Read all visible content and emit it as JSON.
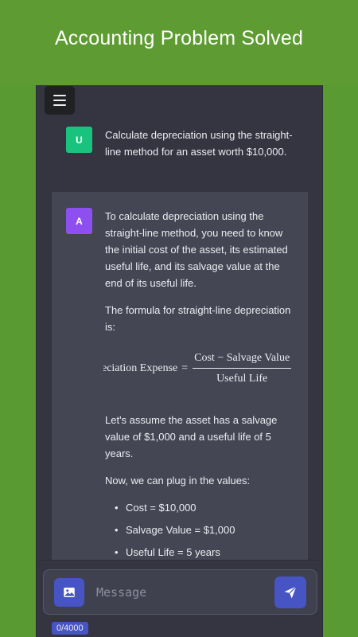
{
  "banner": {
    "title": "Accounting Problem Solved"
  },
  "chat": {
    "user_message": {
      "avatar_letter": "U",
      "avatar_color": "#19c37d",
      "text": "Calculate depreciation using the straight-line method for an asset worth $10,000."
    },
    "ai_message": {
      "avatar_letter": "A",
      "avatar_color": "#8e4ff0",
      "paragraph_1": "To calculate depreciation using the straight-line method, you need to know the initial cost of the asset, its estimated useful life, and its salvage value at the end of its useful life.",
      "paragraph_2": "The formula for straight-line depreciation is:",
      "formula": {
        "lhs": "Depreciation Expense",
        "equals": "=",
        "numerator": "Cost − Salvage Value",
        "denominator": "Useful Life"
      },
      "paragraph_3": "Let's assume the asset has a salvage value of $1,000 and a useful life of 5 years.",
      "paragraph_4": "Now, we can plug in the values:",
      "list": [
        "Cost = $10,000",
        "Salvage Value = $1,000",
        "Useful Life = 5 years"
      ]
    }
  },
  "composer": {
    "placeholder": "Message",
    "char_counter": "0/4000",
    "image_button_icon": "image-icon",
    "send_button_icon": "send-icon"
  },
  "theme": {
    "banner_bg": "#5e9b33",
    "chat_bg": "#343541",
    "ai_bg": "#444654",
    "accent": "#4654c4"
  }
}
